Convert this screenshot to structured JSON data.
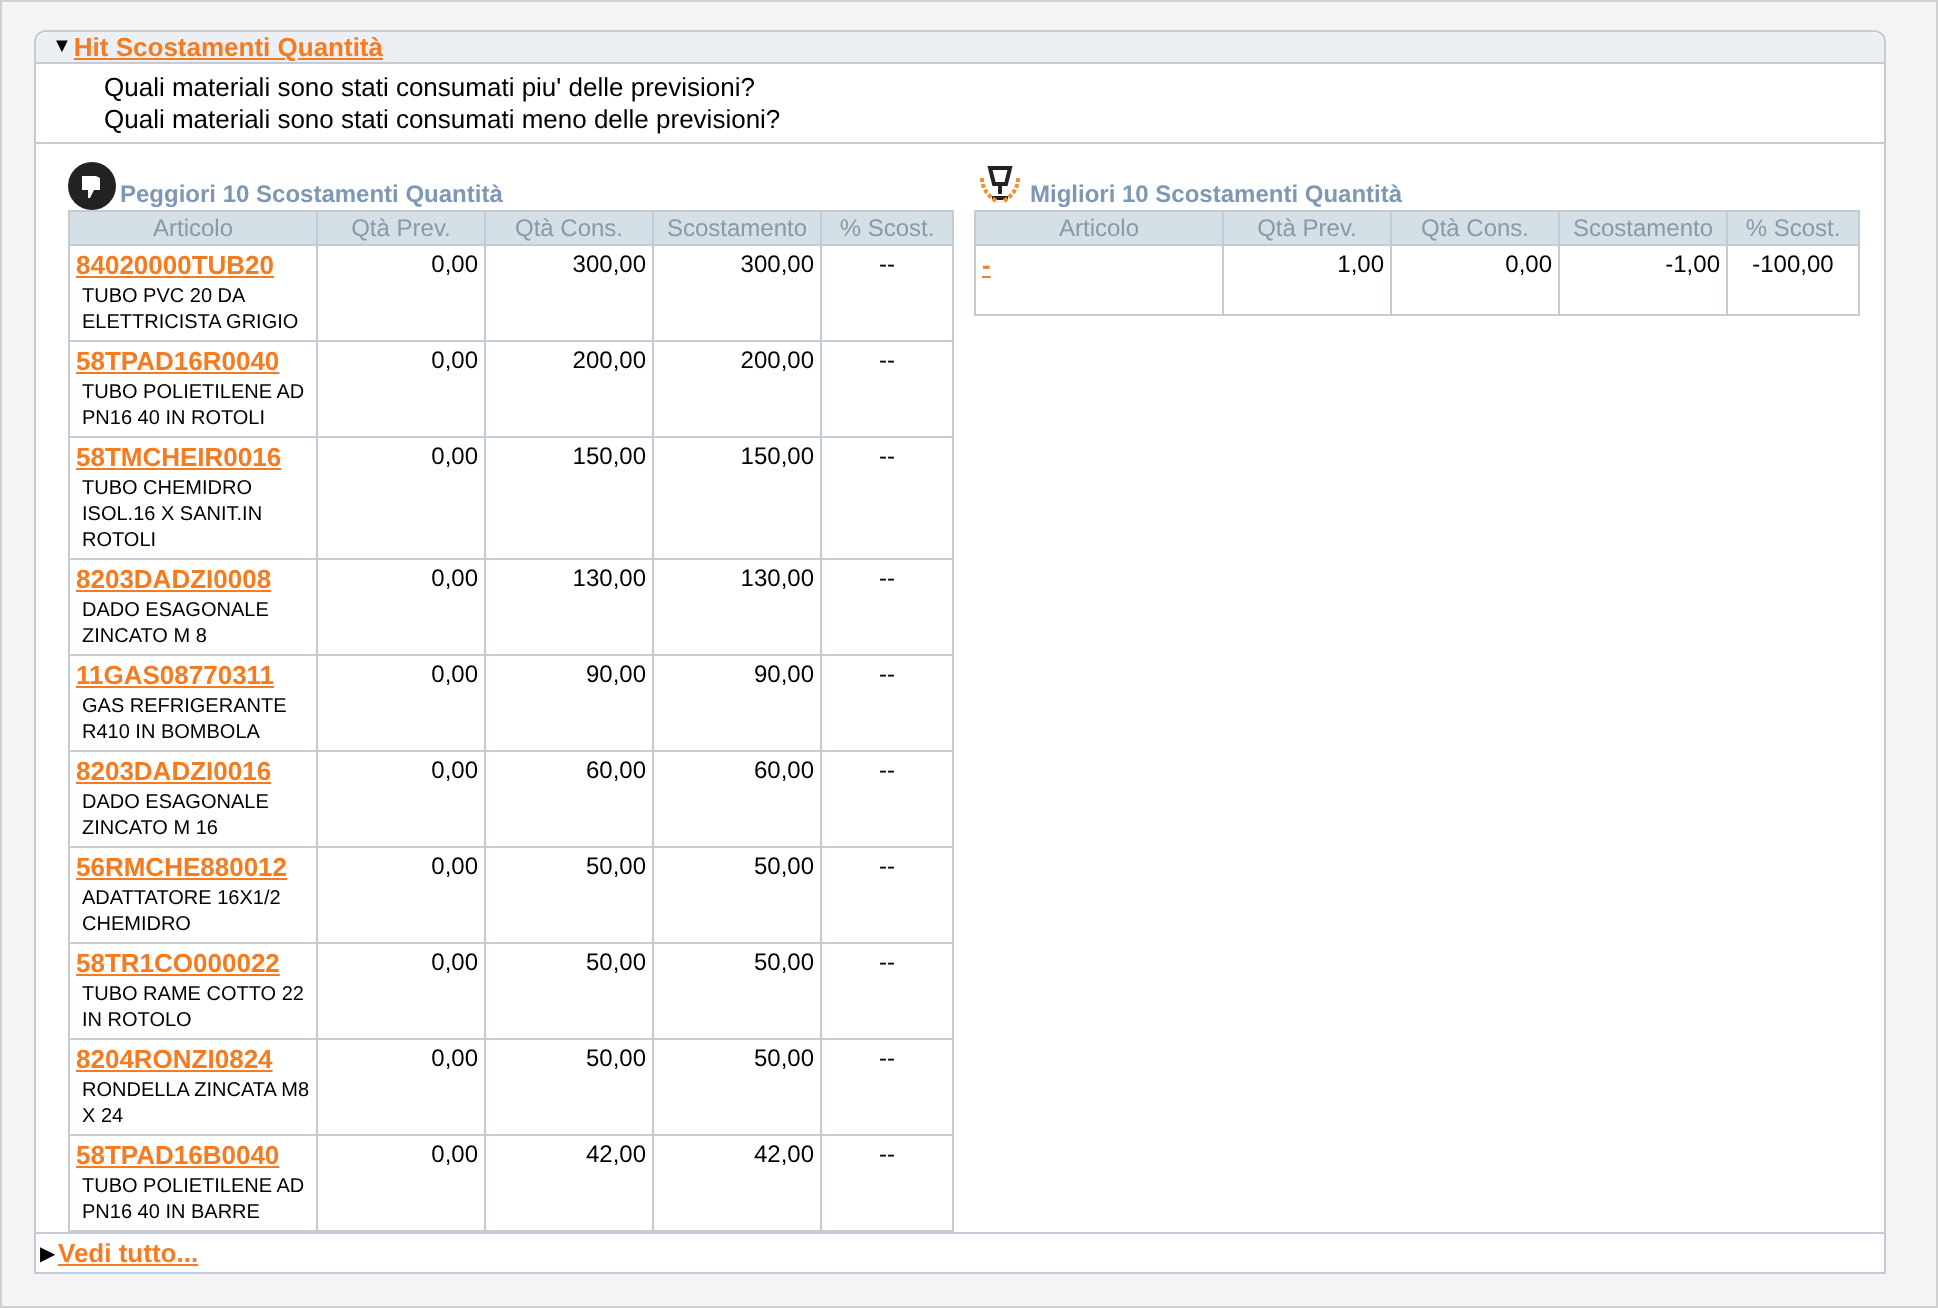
{
  "section": {
    "toggle": "▼",
    "title": "Hit Scostamenti Quantità",
    "questions": [
      "Quali materiali sono stati consumati piu' delle previsioni?",
      "Quali materiali sono stati consumati meno delle previsioni?"
    ]
  },
  "tables": [
    {
      "kind": "worst",
      "title": "Peggiori 10 Scostamenti Quantità",
      "columns": [
        "Articolo",
        "Qtà Prev.",
        "Qtà Cons.",
        "Scostamento",
        "% Scost."
      ],
      "rows": [
        {
          "code": "84020000TUB20",
          "description": "TUBO PVC 20 DA ELETTRICISTA GRIGIO",
          "values": [
            "0,00",
            "300,00",
            "300,00",
            "--"
          ]
        },
        {
          "code": "58TPAD16R0040",
          "description": "TUBO POLIETILENE AD PN16 40 IN ROTOLI",
          "values": [
            "0,00",
            "200,00",
            "200,00",
            "--"
          ]
        },
        {
          "code": "58TMCHEIR0016",
          "description": "TUBO CHEMIDRO ISOL.16 X SANIT.IN ROTOLI",
          "values": [
            "0,00",
            "150,00",
            "150,00",
            "--"
          ]
        },
        {
          "code": "8203DADZI0008",
          "description": "DADO ESAGONALE ZINCATO M 8",
          "values": [
            "0,00",
            "130,00",
            "130,00",
            "--"
          ]
        },
        {
          "code": "11GAS08770311",
          "description": "GAS REFRIGERANTE R410 IN BOMBOLA",
          "values": [
            "0,00",
            "90,00",
            "90,00",
            "--"
          ]
        },
        {
          "code": "8203DADZI0016",
          "description": "DADO ESAGONALE ZINCATO M 16",
          "values": [
            "0,00",
            "60,00",
            "60,00",
            "--"
          ]
        },
        {
          "code": "56RMCHE880012",
          "description": "ADATTATORE 16X1/2 CHEMIDRO",
          "values": [
            "0,00",
            "50,00",
            "50,00",
            "--"
          ]
        },
        {
          "code": "58TR1CO000022",
          "description": "TUBO RAME COTTO 22 IN ROTOLO",
          "values": [
            "0,00",
            "50,00",
            "50,00",
            "--"
          ]
        },
        {
          "code": "8204RONZI0824",
          "description": "RONDELLA ZINCATA M8 X 24",
          "values": [
            "0,00",
            "50,00",
            "50,00",
            "--"
          ]
        },
        {
          "code": "58TPAD16B0040",
          "description": "TUBO POLIETILENE AD PN16 40 IN BARRE",
          "values": [
            "0,00",
            "42,00",
            "42,00",
            "--"
          ]
        }
      ]
    },
    {
      "kind": "best",
      "title": "Migliori 10 Scostamenti Quantità",
      "columns": [
        "Articolo",
        "Qtà Prev.",
        "Qtà Cons.",
        "Scostamento",
        "% Scost."
      ],
      "rows": [
        {
          "code": "-",
          "values": [
            "1,00",
            "0,00",
            "-1,00",
            "-100,00"
          ]
        }
      ]
    }
  ],
  "footer": {
    "toggle": "▶",
    "link": "Vedi tutto..."
  }
}
